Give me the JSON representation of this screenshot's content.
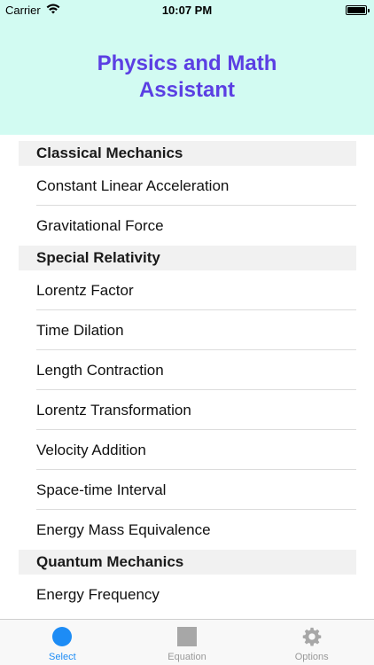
{
  "status": {
    "carrier": "Carrier",
    "time": "10:07 PM"
  },
  "header": {
    "title": "Physics and Math Assistant",
    "background": "#d2fbf2",
    "title_color": "#5b3fe3"
  },
  "sections": [
    {
      "title": "Classical Mechanics",
      "items": [
        "Constant Linear Acceleration",
        "Gravitational Force"
      ]
    },
    {
      "title": "Special Relativity",
      "items": [
        "Lorentz Factor",
        "Time Dilation",
        "Length Contraction",
        "Lorentz Transformation",
        "Velocity Addition",
        "Space-time Interval",
        "Energy Mass Equivalence"
      ]
    },
    {
      "title": "Quantum Mechanics",
      "items": [
        "Energy Frequency"
      ]
    }
  ],
  "tabs": [
    {
      "label": "Select",
      "icon": "circle-icon",
      "active": true
    },
    {
      "label": "Equation",
      "icon": "square-icon",
      "active": false
    },
    {
      "label": "Options",
      "icon": "gear-icon",
      "active": false
    }
  ],
  "accent": "#1d8cf5"
}
